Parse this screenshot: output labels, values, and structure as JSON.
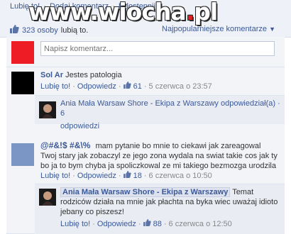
{
  "header": {
    "links": [
      "Lubię to!",
      "Dodaj komentarz",
      "Udostępnij"
    ],
    "separator": "·",
    "watermark_main": "www.wiocha",
    "watermark_dot": ".",
    "watermark_tld": "pl",
    "likes_count": "323 osoby",
    "likes_suffix": "lubią to.",
    "sort_label": "Najpopularniejsze komentarze",
    "sort_caret": "▼"
  },
  "composer": {
    "placeholder": "Napisz komentarz..."
  },
  "comments": [
    {
      "author": "Sol Ar",
      "text": "Jestes patologia",
      "like_label": "Lubię to!",
      "reply_label": "Odpowiedz",
      "likes": "61",
      "date": "5 czerwca o 23:57",
      "reply_summary": {
        "text": "Ania Mała Warsaw Shore - Ekipa z Warszawy odpowiedział(a) · 6",
        "text2": "odpowiedzi"
      }
    },
    {
      "author": "@#&!$ #&\\%",
      "text_line1": "mam pytanie bo mnie to ciekawi jak zareagowal",
      "text_line2": "Twoj stary jak zobaczyl ze jego zona wydala na swiat takie cos jak ty",
      "text_line3": "bo ja to bym chyba ja spoliczkowal ze mi takiego bezmozga urodzila",
      "like_label": "Lubię to!",
      "reply_label": "Odpowiedz",
      "likes": "18",
      "date": "6 czerwca o 10:50",
      "reply": {
        "author": "Ania Mała Warsaw Shore - Ekipa z Warszawy",
        "text_after_name": "Temat",
        "text_line2": "rodziców działa na mnie jak płachta na byka wiec uważaj idioto",
        "text_line3": "jebany co piszesz!",
        "like_label": "Lubię to!",
        "reply_label": "Odpowiedz",
        "likes": "88",
        "date": "6 czerwca o 12:50"
      }
    }
  ],
  "colors": {
    "link": "#3b5998",
    "red_avatar": "#ee1c24",
    "panel": "#f2f4f8"
  }
}
